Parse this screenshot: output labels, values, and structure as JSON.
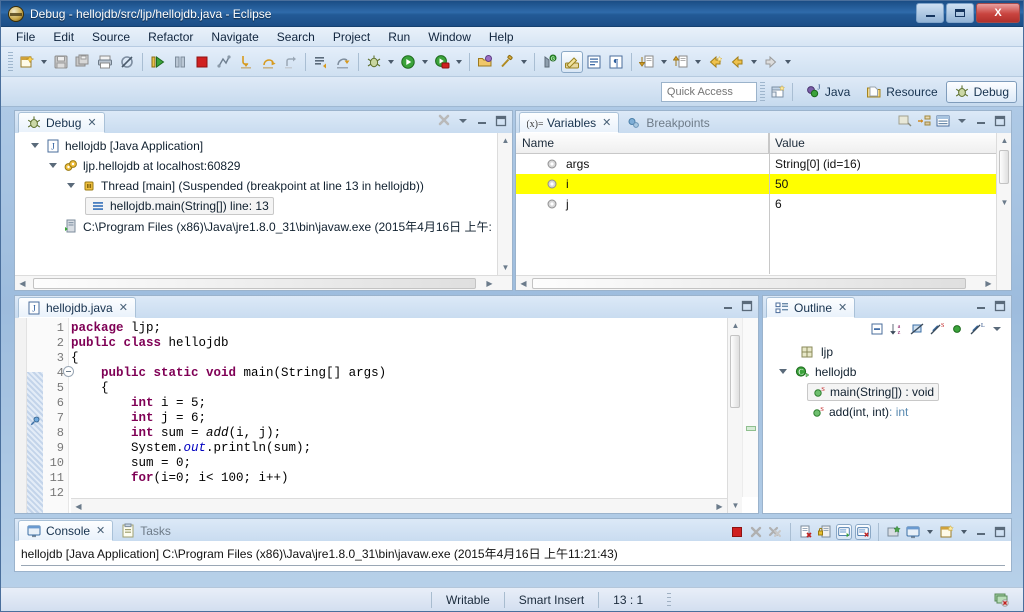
{
  "window": {
    "title": "Debug - hellojdb/src/ljp/hellojdb.java - Eclipse",
    "minimize_label": "Minimize",
    "maximize_label": "Maximize",
    "close_label": "X"
  },
  "menu": [
    {
      "label": "File",
      "accel": "F"
    },
    {
      "label": "Edit",
      "accel": "E"
    },
    {
      "label": "Source",
      "accel": "S"
    },
    {
      "label": "Refactor",
      "accel": "t"
    },
    {
      "label": "Navigate",
      "accel": "N"
    },
    {
      "label": "Search",
      "accel": "a"
    },
    {
      "label": "Project",
      "accel": "P"
    },
    {
      "label": "Run",
      "accel": "R"
    },
    {
      "label": "Window",
      "accel": "W"
    },
    {
      "label": "Help",
      "accel": "H"
    }
  ],
  "toolbar": {
    "items": [
      "new-wizard-icon",
      "save-icon",
      "save-all-icon",
      "print-icon",
      "skip-breakpoints-icon",
      "resume-icon",
      "suspend-icon",
      "terminate-icon",
      "disconnect-icon",
      "step-into-icon",
      "step-over-icon",
      "step-return-icon",
      "drop-to-frame-icon",
      "use-step-filters-icon",
      "debug-icon",
      "run-icon",
      "run-coverage-icon",
      "open-type-icon",
      "search-icon",
      "new-java-project-icon",
      "toggle-mark-occurrences-icon",
      "show-whitespace-icon",
      "show-source-quick-icon",
      "next-annotation-icon",
      "previous-annotation-icon",
      "back-icon",
      "forward-icon",
      "last-edit-icon"
    ]
  },
  "perspective": {
    "quick_access_placeholder": "Quick Access",
    "open_perspective_icon": "open-perspective-icon",
    "buttons": [
      {
        "label": "Java",
        "icon": "java-perspective-icon",
        "active": false
      },
      {
        "label": "Resource",
        "icon": "resource-perspective-icon",
        "active": false
      },
      {
        "label": "Debug",
        "icon": "debug-perspective-icon",
        "active": true
      }
    ]
  },
  "debug_view": {
    "tab_label": "Debug",
    "tab_icon": "debug-icon",
    "tools": [
      "disconnect-all-icon",
      "view-menu-icon",
      "minimize-icon",
      "maximize-icon"
    ],
    "tree": [
      {
        "indent": 0,
        "twisty": "open",
        "icon": "launch-icon",
        "label": "hellojdb [Java Application]",
        "selected": false
      },
      {
        "indent": 1,
        "twisty": "open",
        "icon": "debug-target-icon",
        "label": "ljp.hellojdb at localhost:60829",
        "selected": false
      },
      {
        "indent": 2,
        "twisty": "open",
        "icon": "thread-suspended-icon",
        "label": "Thread [main] (Suspended (breakpoint at line 13 in hellojdb))",
        "selected": false
      },
      {
        "indent": 3,
        "twisty": "none",
        "icon": "stack-frame-icon",
        "label": "hellojdb.main(String[]) line: 13",
        "selected": true
      },
      {
        "indent": 1,
        "twisty": "none",
        "icon": "process-icon",
        "label": "C:\\Program Files (x86)\\Java\\jre1.8.0_31\\bin\\javaw.exe (2015年4月16日 上午:",
        "selected": false
      }
    ]
  },
  "variables_view": {
    "tabs": [
      {
        "label": "Variables",
        "icon": "variables-icon",
        "active": true
      },
      {
        "label": "Breakpoints",
        "icon": "breakpoints-icon",
        "active": false
      }
    ],
    "tools": [
      "collapse-all-icon",
      "show-logical-structure-icon",
      "show-detail-pane-icon",
      "view-menu-icon",
      "minimize-icon",
      "maximize-icon"
    ],
    "columns": [
      "Name",
      "Value"
    ],
    "rows": [
      {
        "icon": "local-variable-icon",
        "name": "args",
        "value": "String[0]  (id=16)",
        "highlight": false
      },
      {
        "icon": "local-variable-icon",
        "name": "i",
        "value": "50",
        "highlight": true
      },
      {
        "icon": "local-variable-icon",
        "name": "j",
        "value": "6",
        "highlight": false
      }
    ]
  },
  "editor": {
    "tab_label": "hellojdb.java",
    "tab_icon": "java-file-icon",
    "tools": [
      "minimize-icon",
      "maximize-icon"
    ],
    "lines": [
      {
        "num": "1",
        "text": "package ljp;"
      },
      {
        "num": "2",
        "text": "public class hellojdb"
      },
      {
        "num": "3",
        "text": "{"
      },
      {
        "num": "4",
        "text": "    public static void main(String[] args)"
      },
      {
        "num": "5",
        "text": "    {"
      },
      {
        "num": "6",
        "text": "        int i = 5;"
      },
      {
        "num": "7",
        "text": "        int j = 6;"
      },
      {
        "num": "8",
        "text": "        int sum = add(i, j);"
      },
      {
        "num": "9",
        "text": "        System.out.println(sum);"
      },
      {
        "num": "10",
        "text": ""
      },
      {
        "num": "11",
        "text": "        sum = 0;"
      },
      {
        "num": "12",
        "text": "        for(i=0; i< 100; i++)"
      }
    ]
  },
  "outline_view": {
    "tab_label": "Outline",
    "tab_icon": "outline-icon",
    "tools": [
      "collapse-all-icon",
      "sort-icon",
      "hide-fields-icon",
      "hide-static-icon",
      "hide-nonpublic-icon",
      "hide-local-types-icon",
      "view-menu-icon",
      "minimize-icon",
      "maximize-icon"
    ],
    "tree": [
      {
        "indent": 1,
        "twisty": "none",
        "icon": "package-icon",
        "label": "ljp",
        "type": "",
        "selected": false
      },
      {
        "indent": 0,
        "twisty": "open",
        "icon": "class-icon",
        "label": "hellojdb",
        "type": "",
        "selected": false
      },
      {
        "indent": 2,
        "twisty": "none",
        "icon": "method-public-static-icon",
        "label": "main(String[]) : void",
        "type": "",
        "selected": true
      },
      {
        "indent": 2,
        "twisty": "none",
        "icon": "method-public-static-icon",
        "label": "add(int, int) ",
        "type": ": int",
        "selected": false
      }
    ]
  },
  "console_view": {
    "tabs": [
      {
        "label": "Console",
        "icon": "console-icon",
        "active": true
      },
      {
        "label": "Tasks",
        "icon": "tasks-icon",
        "active": false
      }
    ],
    "tools": [
      "terminate-icon",
      "remove-launch-icon",
      "remove-all-terminated-icon",
      "clear-console-icon",
      "scroll-lock-icon",
      "show-console-on-output-icon",
      "show-console-on-error-icon",
      "pin-console-icon",
      "display-selected-console-icon",
      "open-console-icon",
      "minimize-icon",
      "maximize-icon"
    ],
    "content": "hellojdb [Java Application] C:\\Program Files (x86)\\Java\\jre1.8.0_31\\bin\\javaw.exe (2015年4月16日 上午11:21:43)"
  },
  "statusbar": {
    "writable": "Writable",
    "insert_mode": "Smart Insert",
    "position": "13 : 1",
    "tray_icon": "console-tray-icon"
  },
  "colors": {
    "title_blue": "#2f6bab",
    "highlight_yellow": "#ffff00",
    "keyword_purple": "#7f0055",
    "field_blue": "#0000c0",
    "terminate_red": "#d02020",
    "run_green": "#2f9e2f"
  }
}
